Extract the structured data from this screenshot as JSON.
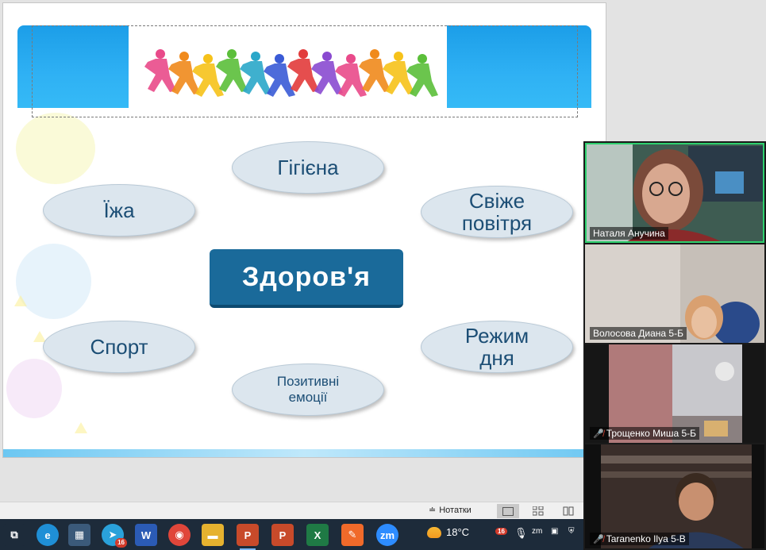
{
  "slide": {
    "center_topic": "Здоров'я",
    "items": [
      {
        "label": "Гігієна"
      },
      {
        "label": "Їжа"
      },
      {
        "label": "Свіже\nповітря"
      },
      {
        "label": "Спорт"
      },
      {
        "label": "Режим\nдня"
      },
      {
        "label": "Позитивні\nемоції"
      }
    ],
    "banner_colors": [
      "#e94a8a",
      "#f08a1c",
      "#f6c21a",
      "#5bbf3a",
      "#2aa7c9",
      "#3a5bd6",
      "#e23b3b",
      "#8a4ad0"
    ]
  },
  "statusbar": {
    "notes_label": "Нотатки"
  },
  "taskbar": {
    "apps": [
      {
        "name": "task-view-icon",
        "glyph": "⧉"
      },
      {
        "name": "edge-icon",
        "glyph": "e"
      },
      {
        "name": "calculator-icon",
        "glyph": "▦"
      },
      {
        "name": "telegram-icon",
        "glyph": "➤",
        "badge": "16"
      },
      {
        "name": "word-icon",
        "glyph": "W"
      },
      {
        "name": "chrome-icon",
        "glyph": "◉"
      },
      {
        "name": "file-explorer-icon",
        "glyph": "▬"
      },
      {
        "name": "powerpoint-icon",
        "glyph": "P"
      },
      {
        "name": "powerpoint-second-icon",
        "glyph": "P"
      },
      {
        "name": "excel-icon",
        "glyph": "X"
      },
      {
        "name": "draw-app-icon",
        "glyph": "✎"
      },
      {
        "name": "zoom-icon",
        "glyph": "zm"
      }
    ],
    "temperature": "18°C",
    "tray_badge": "16"
  },
  "participants": [
    {
      "name": "Наталя Анучина",
      "muted": false,
      "speaking": true
    },
    {
      "name": "Волосова Диана 5-Б",
      "muted": false,
      "speaking": false
    },
    {
      "name": "Трощенко Миша 5-Б",
      "muted": true,
      "speaking": false
    },
    {
      "name": "Taranenko Ilya 5-B",
      "muted": true,
      "speaking": false
    }
  ]
}
